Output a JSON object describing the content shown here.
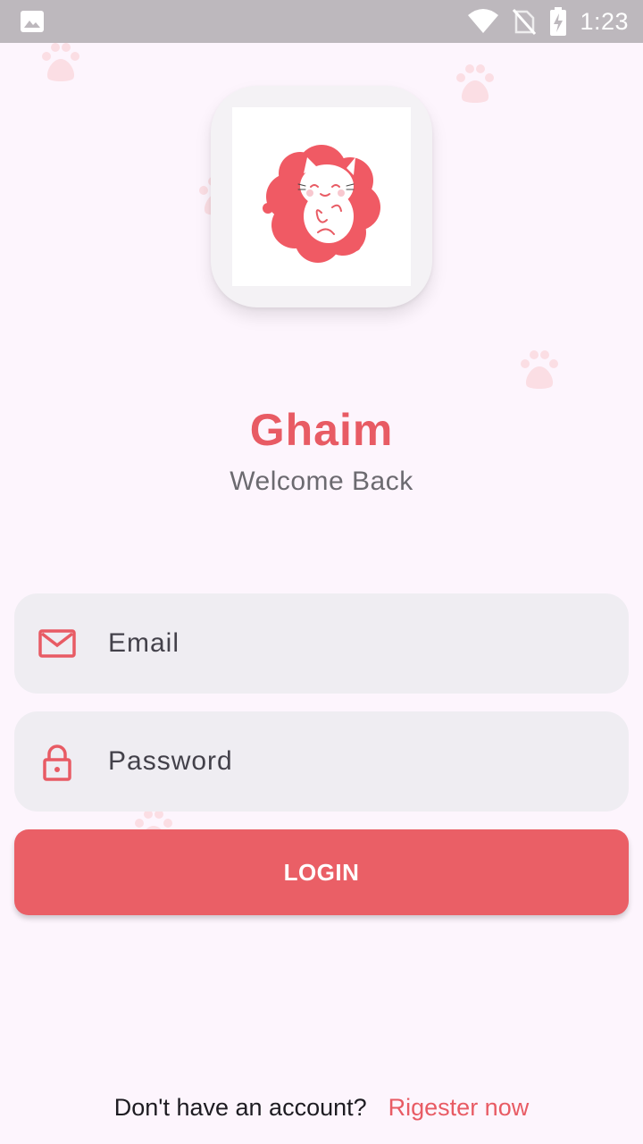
{
  "status_bar": {
    "time": "1:23",
    "icons": [
      "gallery-icon",
      "wifi-icon",
      "no-sim-icon",
      "battery-charging-icon"
    ]
  },
  "app": {
    "title": "Ghaim",
    "subtitle": "Welcome Back",
    "logo": "cat-on-red-flower-logo"
  },
  "form": {
    "email": {
      "placeholder": "Email",
      "icon": "mail-icon"
    },
    "password": {
      "placeholder": "Password",
      "icon": "lock-icon"
    },
    "login_label": "LOGIN"
  },
  "footer": {
    "question": "Don't have an account?",
    "register_link": "Rigester now"
  },
  "colors": {
    "accent": "#e85b64",
    "background": "#fdf5fd",
    "field_bg": "#efedf2",
    "status_bar": "#bdb8bd"
  }
}
